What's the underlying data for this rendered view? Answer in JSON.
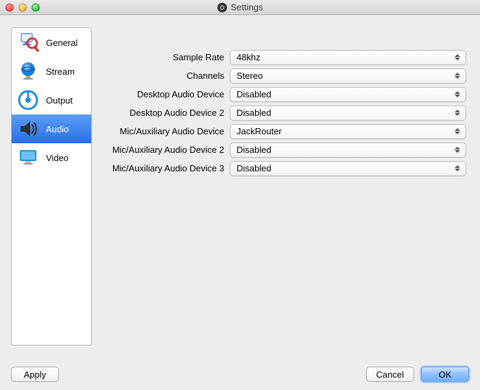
{
  "window": {
    "title": "Settings"
  },
  "sidebar": {
    "items": [
      {
        "label": "General"
      },
      {
        "label": "Stream"
      },
      {
        "label": "Output"
      },
      {
        "label": "Audio"
      },
      {
        "label": "Video"
      }
    ],
    "selected_index": 3
  },
  "form": {
    "rows": [
      {
        "label": "Sample Rate",
        "value": "48khz"
      },
      {
        "label": "Channels",
        "value": "Stereo"
      },
      {
        "label": "Desktop Audio Device",
        "value": "Disabled"
      },
      {
        "label": "Desktop Audio Device 2",
        "value": "Disabled"
      },
      {
        "label": "Mic/Auxiliary Audio Device",
        "value": "JackRouter"
      },
      {
        "label": "Mic/Auxiliary Audio Device 2",
        "value": "Disabled"
      },
      {
        "label": "Mic/Auxiliary Audio Device 3",
        "value": "Disabled"
      }
    ]
  },
  "buttons": {
    "apply": "Apply",
    "cancel": "Cancel",
    "ok": "OK"
  }
}
